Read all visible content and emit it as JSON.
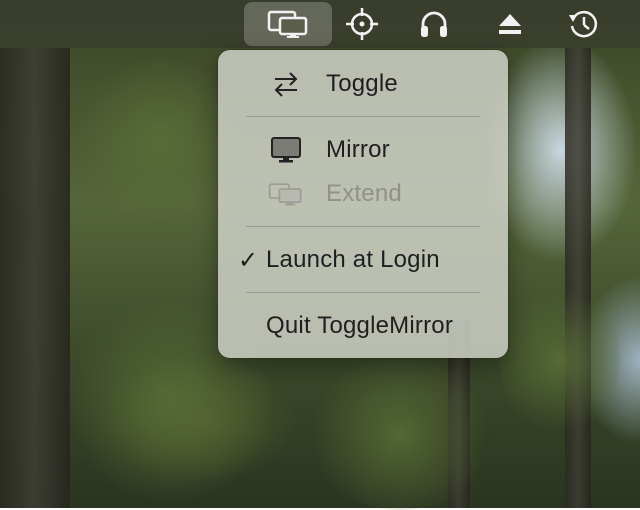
{
  "menubar": {
    "items": [
      {
        "icon": "displays-icon",
        "active": true
      },
      {
        "icon": "crosshair-icon"
      },
      {
        "icon": "headphones-icon"
      },
      {
        "icon": "eject-icon"
      },
      {
        "icon": "time-machine-icon"
      }
    ]
  },
  "menu": {
    "toggle_label": "Toggle",
    "mirror_label": "Mirror",
    "extend_label": "Extend",
    "launch_label": "Launch at Login",
    "launch_checked": "✓",
    "quit_label": "Quit ToggleMirror"
  },
  "colors": {
    "menubar_bg": "#3a3e2c",
    "menu_bg": "#cdd0c6",
    "text": "#1f1f1f",
    "disabled_text": "#8f918a"
  }
}
